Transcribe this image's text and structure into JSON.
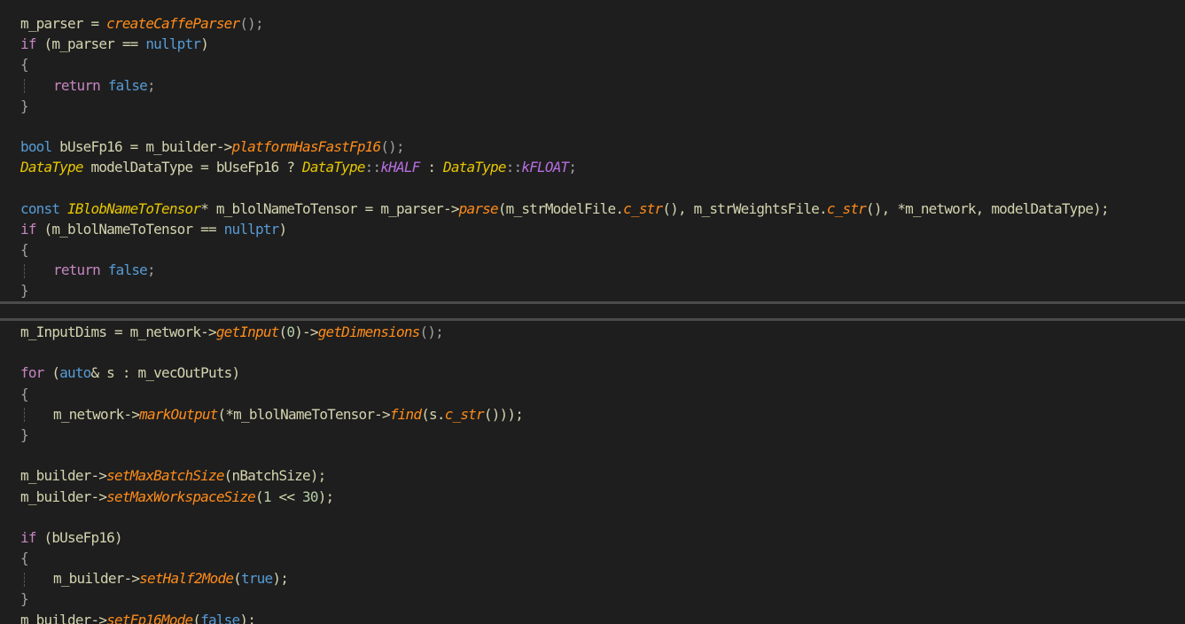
{
  "editor": {
    "top_pane": {
      "lines": [
        [
          [
            "txt",
            "m_parser = "
          ],
          [
            "fn",
            "createCaffeParser"
          ],
          [
            "pun",
            "();"
          ]
        ],
        [
          [
            "ctl",
            "if"
          ],
          [
            "txt",
            " (m_parser == "
          ],
          [
            "kw",
            "nullptr"
          ],
          [
            "txt",
            ")"
          ]
        ],
        [
          [
            "pun",
            "{"
          ]
        ],
        [
          [
            "guide",
            ""
          ],
          [
            "ctl",
            "return"
          ],
          [
            "txt",
            " "
          ],
          [
            "kw",
            "false"
          ],
          [
            "pun",
            ";"
          ]
        ],
        [
          [
            "pun",
            "}"
          ]
        ],
        [],
        [
          [
            "kw",
            "bool"
          ],
          [
            "txt",
            " bUseFp16 = m_builder->"
          ],
          [
            "fn",
            "platformHasFastFp16"
          ],
          [
            "pun",
            "();"
          ]
        ],
        [
          [
            "type",
            "DataType"
          ],
          [
            "txt",
            " modelDataType = bUseFp16 ? "
          ],
          [
            "type",
            "DataType"
          ],
          [
            "pun",
            "::"
          ],
          [
            "enm",
            "kHALF"
          ],
          [
            "txt",
            " : "
          ],
          [
            "type",
            "DataType"
          ],
          [
            "pun",
            "::"
          ],
          [
            "enm",
            "kFLOAT"
          ],
          [
            "pun",
            ";"
          ]
        ],
        [],
        [
          [
            "kw",
            "const"
          ],
          [
            "txt",
            " "
          ],
          [
            "cls",
            "IBlobNameToTensor"
          ],
          [
            "txt",
            "* m_blolNameToTensor = m_parser->"
          ],
          [
            "fn",
            "parse"
          ],
          [
            "txt",
            "(m_strModelFile."
          ],
          [
            "fn",
            "c_str"
          ],
          [
            "txt",
            "(), m_strWeightsFile."
          ],
          [
            "fn",
            "c_str"
          ],
          [
            "txt",
            "(), *m_network, modelDataType);"
          ]
        ],
        [
          [
            "ctl",
            "if"
          ],
          [
            "txt",
            " (m_blolNameToTensor == "
          ],
          [
            "kw",
            "nullptr"
          ],
          [
            "txt",
            ")"
          ]
        ],
        [
          [
            "pun",
            "{"
          ]
        ],
        [
          [
            "guide",
            ""
          ],
          [
            "ctl",
            "return"
          ],
          [
            "txt",
            " "
          ],
          [
            "kw",
            "false"
          ],
          [
            "pun",
            ";"
          ]
        ],
        [
          [
            "pun",
            "}"
          ]
        ]
      ]
    },
    "bottom_pane": {
      "lines": [
        [
          [
            "txt",
            "m_InputDims = m_network->"
          ],
          [
            "fn",
            "getInput"
          ],
          [
            "txt",
            "("
          ],
          [
            "num",
            "0"
          ],
          [
            "txt",
            ")->"
          ],
          [
            "fn",
            "getDimensions"
          ],
          [
            "pun",
            "();"
          ]
        ],
        [],
        [
          [
            "ctl",
            "for"
          ],
          [
            "txt",
            " ("
          ],
          [
            "kw",
            "auto"
          ],
          [
            "txt",
            "& s : m_vecOutPuts)"
          ]
        ],
        [
          [
            "pun",
            "{"
          ]
        ],
        [
          [
            "guide",
            ""
          ],
          [
            "txt",
            "m_network->"
          ],
          [
            "fn",
            "markOutput"
          ],
          [
            "txt",
            "(*m_blolNameToTensor->"
          ],
          [
            "fn",
            "find"
          ],
          [
            "txt",
            "(s."
          ],
          [
            "fn",
            "c_str"
          ],
          [
            "txt",
            "()));"
          ]
        ],
        [
          [
            "pun",
            "}"
          ]
        ],
        [],
        [
          [
            "txt",
            "m_builder->"
          ],
          [
            "fn",
            "setMaxBatchSize"
          ],
          [
            "txt",
            "(nBatchSize);"
          ]
        ],
        [
          [
            "txt",
            "m_builder->"
          ],
          [
            "fn",
            "setMaxWorkspaceSize"
          ],
          [
            "txt",
            "("
          ],
          [
            "num",
            "1"
          ],
          [
            "txt",
            " << "
          ],
          [
            "num",
            "30"
          ],
          [
            "txt",
            ");"
          ]
        ],
        [],
        [
          [
            "ctl",
            "if"
          ],
          [
            "txt",
            " (bUseFp16)"
          ]
        ],
        [
          [
            "pun",
            "{"
          ]
        ],
        [
          [
            "guide",
            ""
          ],
          [
            "txt",
            "m_builder->"
          ],
          [
            "fn",
            "setHalf2Mode"
          ],
          [
            "txt",
            "("
          ],
          [
            "kw",
            "true"
          ],
          [
            "txt",
            ");"
          ]
        ],
        [
          [
            "pun",
            "}"
          ]
        ],
        [
          [
            "txt",
            "m_builder->"
          ],
          [
            "fn",
            "setFp16Mode"
          ],
          [
            "txt",
            "("
          ],
          [
            "kw",
            "false"
          ],
          [
            "txt",
            ");"
          ]
        ]
      ]
    }
  }
}
